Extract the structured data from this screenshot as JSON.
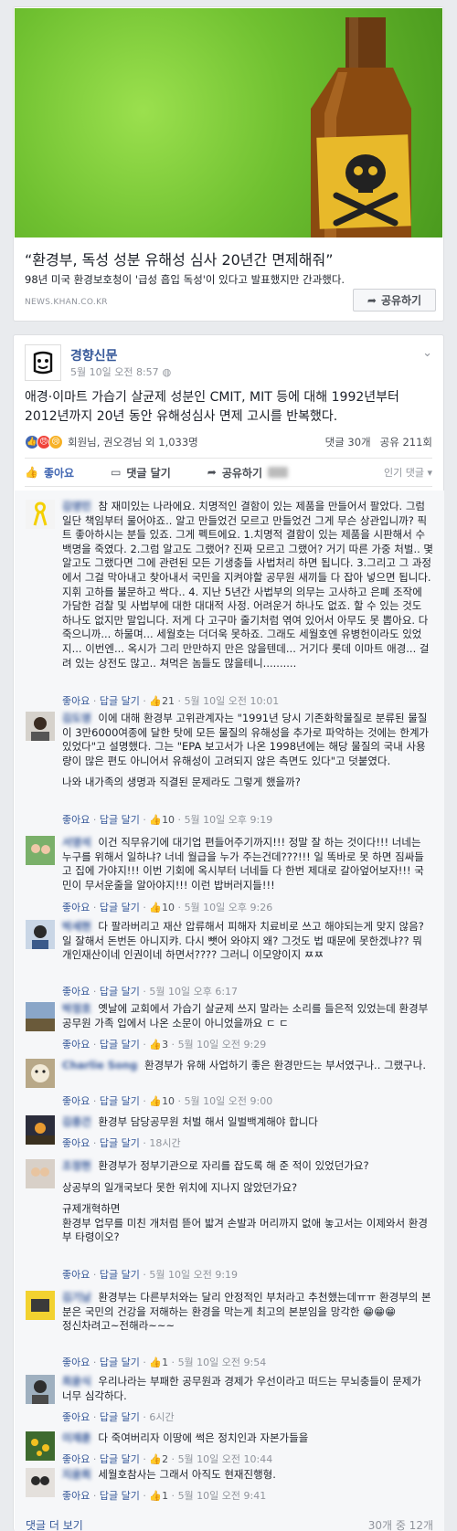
{
  "link_preview": {
    "title": "“환경부, 독성 성분 유해성 심사 20년간 면제해줘”",
    "description": "98년 미국 환경보호청이 '급성 흡입 독성'이 있다고 발표했지만 간과했다.",
    "domain": "NEWS.KHAN.CO.KR",
    "share_label": "공유하기",
    "image_icon": "poison-bottle-skull-image"
  },
  "post": {
    "page_name": "경향신문",
    "timestamp": "5월 10일 오전 8:57",
    "text": "애경·이마트 가습기 살균제 성분인 CMIT, MIT 등에 대해 1992년부터 2012년까지 20년 동안 유해성심사 면제 고시를 반복했다.",
    "reactors": "회원님, 권오경님 외 1,033명",
    "comment_count": "댓글 30개",
    "share_count": "공유 211회",
    "actions": {
      "like": "좋아요",
      "comment": "댓글 달기",
      "share": "공유하기"
    },
    "sort": "인기 댓글 ▾",
    "colors": {
      "link": "#365899",
      "like_blue": "#4267b2",
      "meta_gray": "#90949c"
    }
  },
  "comment_labels": {
    "like": "좋아요",
    "reply": "답글 달기"
  },
  "comments": [
    {
      "name": "김영민",
      "text": "참 재미있는 나라에요. 치명적인 결함이 있는 제품을 만들어서 팔았다. 그럼 일단 책임부터 물어야죠.. 알고 만들었건 모르고 만들었건 그게 무슨 상관입니까? 픽트 좋아하시는 분들 있죠. 그게 펙트에요. 1.치명적 결함이 있는 제품을 시판해서 수백명을 죽였다. 2.그럼 알고도 그랬어? 진짜 모르고 그랬어? 거기 따른 가중 처벌.. 몇 알고도 그랬다면 그에 관련된 모든 기생충들 사법처리 하면 됩니다. 3.그리고 그 과정에서 그걸 막아내고 찾아내서 국민을 지켜야할 공무원 새끼들 다 잡아 넣으면 됩니다. 지휘 고하를 불문하고 싹다.. 4. 지난 5년간 사법부의 의무는 고사하고 은폐 조작에 가담한 검찰 및 사법부에 대한 대대적 사정. 어려운거 하나도 없죠. 할 수 있는 것도 하나도 없지만 말입니다. 저게 다 고구마 줄기처럼 엮여 있어서 아무도 못 뽑아요. 다 죽으니까... 하물며... 세월호는 더더욱 못하죠. 그래도 세월호엔 유병헌이라도 있었지... 이번엔... 옥시가 그리 만만하지 만은 않을텐데... 거기다 롯데 이마트 애경... 걸려 있는 상전도 많고.. 쳐먹은 놈들도 많을테니..........",
      "extra": "",
      "likes": "21",
      "time": "5월 10일 오전 10:01"
    },
    {
      "name": "김도영",
      "text": "이에 대해 환경부 고위관계자는 \"1991년 당시 기존화학물질로 분류된 물질이 3만6000여종에 달한 탓에 모든 물질의 유해성을 추가로 파악하는 것에는 한계가 있었다\"고 설명했다. 그는 \"EPA 보고서가 나온 1998년에는 해당 물질의 국내 사용량이 많은 편도 아니어서 유해성이 고려되지 않은 측면도 있다\"고 덧붙였다.",
      "extra": "나와 내가족의 생명과 직결된 문제라도 그렇게 했을까?",
      "likes": "10",
      "time": "5월 10일 오후 9:19"
    },
    {
      "name": "서영석",
      "text": "이건 직무유기에 대기업 편들어주기까지!!! 정말 잘 하는 것이다!!! 너네는 누구를 위해서 일하냐? 너네 월급을 누가 주는건데???!!! 일 똑바로 못 하면 짐싸들고 집에 가야지!!! 이번 기회에 옥시부터 너네들 다 한번 제대로 갈아엎어보자!!! 국민이 무서운줄을 알아야지!!! 이런 밥버러지들!!!",
      "extra": "",
      "likes": "10",
      "time": "5월 10일 오후 9:26"
    },
    {
      "name": "박세현",
      "text": "다 팔라버리고 재산 압류해서 피해자 치료비로 쓰고 해야되는게 맞지 않음? 일 잘해서 돈번돈 아니지캬. 다시 뺏어 와야지 왜? 그것도 법 때문에 못한겠냐?? 뭐 개인재산이네 인권이네 하면서???? 그러니 이모양이지 ㅉㅉ",
      "extra": "",
      "likes": "",
      "time": "5월 10일 오후 6:17"
    },
    {
      "name": "박정호",
      "text": "옛날에 교회에서 가습기 살균제 쓰지 말라는 소리를 들은적 있었는데 환경부 공무원 가족 입에서 나온 소문이 아니었을까요 ㄷ ㄷ",
      "extra": "",
      "likes": "3",
      "time": "5월 10일 오전 9:29"
    },
    {
      "name": "Charlie Song",
      "text": "환경부가 유해 사업하기 좋은 환경만드는 부서였구나.. 그랬구나.",
      "extra": "",
      "likes": "10",
      "time": "5월 10일 오전 9:00"
    },
    {
      "name": "김종건",
      "text": "환경부 담당공무원 처벌 해서 일벌백계해야 합니다",
      "extra": "",
      "likes": "",
      "time": "18시간"
    },
    {
      "name": "조정현",
      "text": "환경부가 정부기관으로 자리를 잡도록 해 준 적이 있었던가요?",
      "extra": "상공부의 일개국보다 못한 위치에 지나지 않았던가요?",
      "extra2": "규제개혁하면\n환경부 업무를 미친 개처럼 뜯어 밟겨 손발과 머리까지 없애 놓고서는 이제와서 환경부 타령이오?",
      "likes": "",
      "time": "5월 10일 오전 9:19"
    },
    {
      "name": "김기남",
      "text": "환경부는 다른부처와는 달리 안정적인 부처라고 추천했는데ㅠㅠ 환경부의 본분은 국민의 건강을 저해하는 환경을 막는게 최고의 본분임을 망각한 😁😁😁",
      "extra": "정신차려고~전해라~~~",
      "likes": "1",
      "time": "5월 10일 오전 9:54"
    },
    {
      "name": "최윤식",
      "text": "우리나라는 부패한 공무원과 경제가 우선이라고 떠드는 무뇌충들이 문제가 너무 심각하다.",
      "extra": "",
      "likes": "",
      "time": "6시간"
    },
    {
      "name": "이재훈",
      "text": "다 죽여버리자 이땅에 썩은 정치인과 자본가들을",
      "extra": "",
      "likes": "2",
      "time": "5월 10일 오전 10:44"
    },
    {
      "name": "지윤희",
      "text": "세월호참사는 그래서 아직도 현재진행형.",
      "extra": "",
      "likes": "1",
      "time": "5월 10일 오전 9:41"
    }
  ],
  "footer": {
    "more_comments": "댓글 더 보기",
    "count_label": "30개 중 12개"
  }
}
